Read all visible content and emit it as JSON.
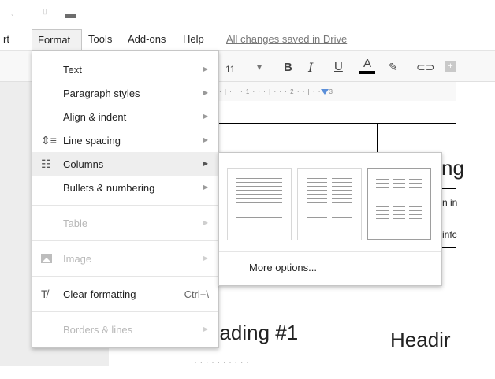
{
  "menubar": {
    "partial_insert": "rt",
    "format": "Format",
    "tools": "Tools",
    "addons": "Add-ons",
    "help": "Help",
    "saved_status": "All changes saved in Drive"
  },
  "toolbar": {
    "font_size": "11",
    "bold": "B",
    "italic": "I",
    "underline": "U",
    "text_color": "A",
    "ruler_ticks": "· | · · · 1 · · · | · · · 2 · · | · · · 3 ·"
  },
  "format_menu": {
    "items": [
      {
        "label": "Text",
        "has_submenu": true
      },
      {
        "label": "Paragraph styles",
        "has_submenu": true
      },
      {
        "label": "Align & indent",
        "has_submenu": true
      },
      {
        "label": "Line spacing",
        "has_submenu": true,
        "icon": "line-spacing-icon"
      },
      {
        "label": "Columns",
        "has_submenu": true,
        "icon": "columns-icon",
        "highlighted": true
      },
      {
        "label": "Bullets & numbering",
        "has_submenu": true
      },
      {
        "label": "Table",
        "has_submenu": true,
        "disabled": true
      },
      {
        "label": "Image",
        "has_submenu": true,
        "disabled": true,
        "icon": "image-icon"
      },
      {
        "label": "Clear formatting",
        "shortcut": "Ctrl+\\",
        "icon": "clear-formatting-icon"
      },
      {
        "label": "Borders & lines",
        "has_submenu": true,
        "disabled": true
      }
    ]
  },
  "columns_menu": {
    "options": [
      "one-column",
      "two-columns",
      "three-columns"
    ],
    "selected": "three-columns",
    "more_options": "More options..."
  },
  "document": {
    "heading_right_partial": "ng",
    "row1_partial": "n in",
    "row2_partial": "infc",
    "heading1_partial": "eading #1",
    "heading2_partial": "Headir"
  },
  "colors": {
    "menu_highlight": "#eeeeee",
    "gutter": "#ededed",
    "ruler_marker": "#5b8fd9"
  }
}
